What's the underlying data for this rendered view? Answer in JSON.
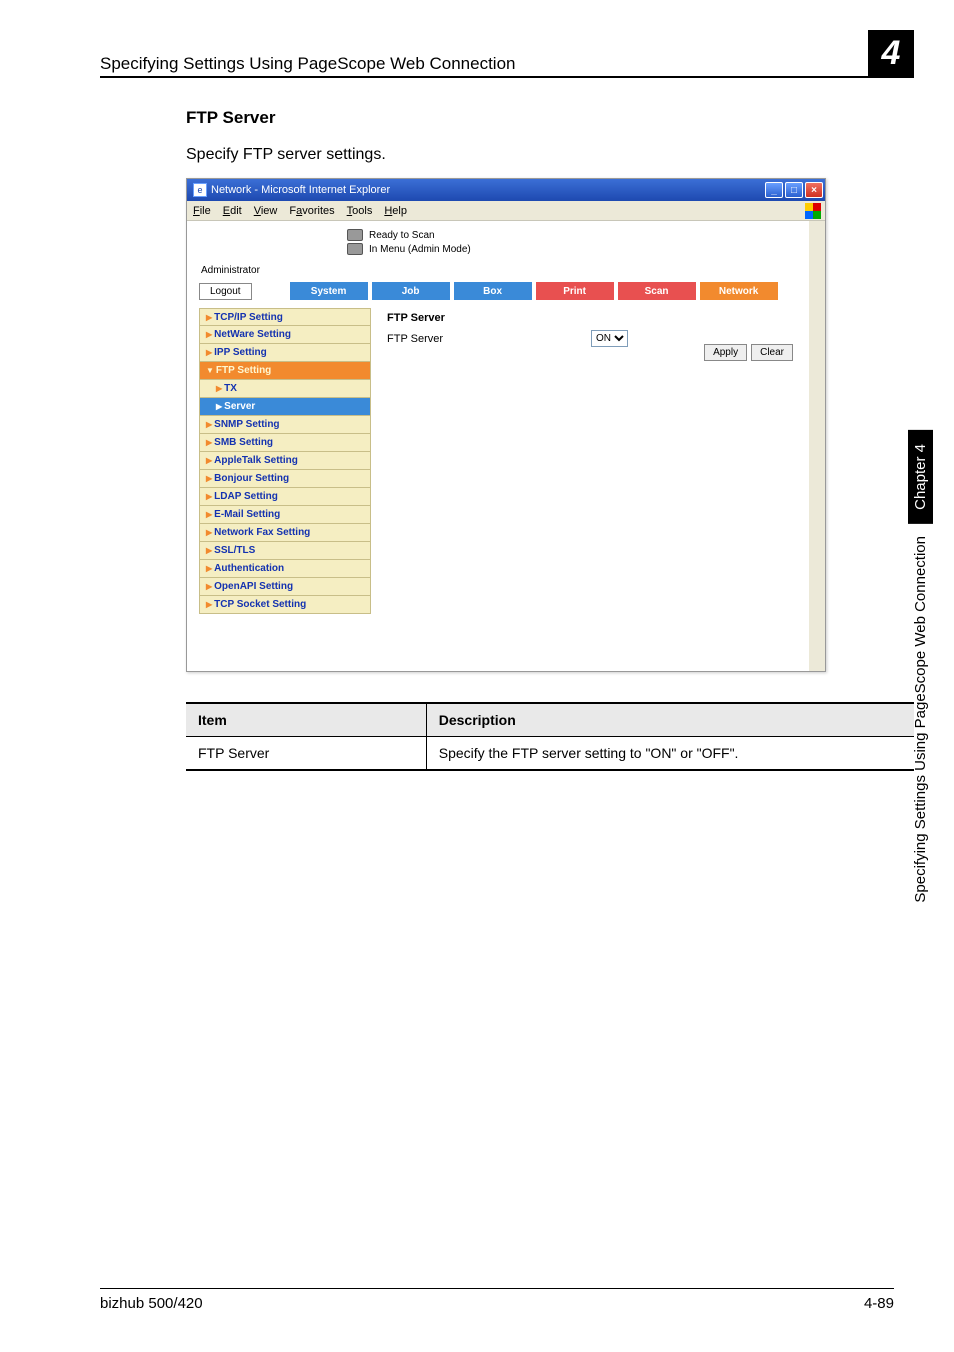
{
  "header": {
    "title": "Specifying Settings Using PageScope Web Connection",
    "chapter_num": "4"
  },
  "section": {
    "heading": "FTP Server",
    "text": "Specify FTP server settings."
  },
  "window": {
    "title": "Network - Microsoft Internet Explorer",
    "menus": [
      "File",
      "Edit",
      "View",
      "Favorites",
      "Tools",
      "Help"
    ],
    "status1": "Ready to Scan",
    "status2": "In Menu (Admin Mode)",
    "admin_label": "Administrator",
    "logout": "Logout",
    "tabs": [
      "System",
      "Job",
      "Box",
      "Print",
      "Scan",
      "Network"
    ],
    "sidebar": [
      {
        "label": "TCP/IP Setting",
        "type": "norm"
      },
      {
        "label": "NetWare Setting",
        "type": "norm"
      },
      {
        "label": "IPP Setting",
        "type": "norm"
      },
      {
        "label": "FTP Setting",
        "type": "active"
      },
      {
        "label": "TX",
        "type": "sub"
      },
      {
        "label": "Server",
        "type": "selected"
      },
      {
        "label": "SNMP Setting",
        "type": "norm"
      },
      {
        "label": "SMB Setting",
        "type": "norm"
      },
      {
        "label": "AppleTalk Setting",
        "type": "norm"
      },
      {
        "label": "Bonjour Setting",
        "type": "norm"
      },
      {
        "label": "LDAP Setting",
        "type": "norm"
      },
      {
        "label": "E-Mail Setting",
        "type": "norm"
      },
      {
        "label": "Network Fax Setting",
        "type": "norm"
      },
      {
        "label": "SSL/TLS",
        "type": "norm"
      },
      {
        "label": "Authentication",
        "type": "norm"
      },
      {
        "label": "OpenAPI Setting",
        "type": "norm"
      },
      {
        "label": "TCP Socket Setting",
        "type": "norm"
      }
    ],
    "pane": {
      "title": "FTP Server",
      "field_label": "FTP Server",
      "select_value": "ON",
      "apply": "Apply",
      "clear": "Clear"
    }
  },
  "table": {
    "head_item": "Item",
    "head_desc": "Description",
    "row_item": "FTP Server",
    "row_desc": "Specify the FTP server setting to \"ON\" or \"OFF\"."
  },
  "sidetab": {
    "chapter": "Chapter 4",
    "long": "Specifying Settings Using PageScope Web Connection"
  },
  "footer": {
    "left": "bizhub 500/420",
    "right": "4-89"
  }
}
